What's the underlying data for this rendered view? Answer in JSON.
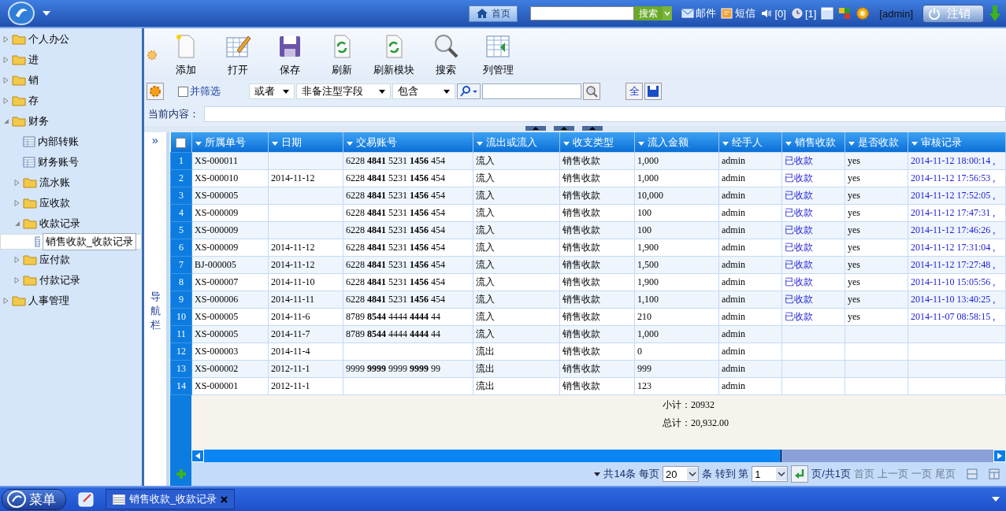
{
  "topbar": {
    "home": "首页",
    "search_button": "搜索",
    "mail": "邮件",
    "sms": "短信",
    "sound_count": "[0]",
    "reminder_count": "[1]",
    "user": "[admin]",
    "logout": "注销"
  },
  "sidebar": {
    "items": [
      {
        "label": "个人办公",
        "kind": "folder",
        "expanded": false,
        "selected": false
      },
      {
        "label": "进",
        "kind": "folder",
        "expanded": false,
        "selected": false
      },
      {
        "label": "销",
        "kind": "folder",
        "expanded": false,
        "selected": false
      },
      {
        "label": "存",
        "kind": "folder",
        "expanded": false,
        "selected": false
      },
      {
        "label": "财务",
        "kind": "folder",
        "expanded": true,
        "selected": false,
        "children": [
          {
            "label": "内部转账",
            "kind": "page",
            "selected": false
          },
          {
            "label": "财务账号",
            "kind": "page",
            "selected": false
          },
          {
            "label": "流水账",
            "kind": "folder",
            "expanded": false,
            "selected": false
          },
          {
            "label": "应收款",
            "kind": "folder",
            "expanded": false,
            "selected": false
          },
          {
            "label": "收款记录",
            "kind": "folder",
            "expanded": true,
            "selected": false,
            "children": [
              {
                "label": "销售收款_收款记录",
                "kind": "page",
                "selected": true
              }
            ]
          },
          {
            "label": "应付款",
            "kind": "folder",
            "expanded": false,
            "selected": false
          },
          {
            "label": "付款记录",
            "kind": "folder",
            "expanded": false,
            "selected": false
          }
        ]
      },
      {
        "label": "人事管理",
        "kind": "folder",
        "expanded": false,
        "selected": false
      }
    ]
  },
  "toolbar": [
    {
      "label": "添加",
      "kind": "add"
    },
    {
      "label": "打开",
      "kind": "open"
    },
    {
      "label": "保存",
      "kind": "save"
    },
    {
      "label": "刷新",
      "kind": "refresh"
    },
    {
      "label": "刷新模块",
      "kind": "refresh"
    },
    {
      "label": "搜索",
      "kind": "search"
    },
    {
      "label": "列管理",
      "kind": "columns"
    }
  ],
  "filter": {
    "combine_label": "并筛选",
    "combine_checked": false,
    "logic": "或者",
    "field": "非备注型字段",
    "operator": "包含",
    "select_all": "全"
  },
  "current_content": {
    "label": "当前内容："
  },
  "nav_strip": {
    "expand": "»",
    "label": "导航栏"
  },
  "table": {
    "header_checked": false,
    "columns": [
      {
        "label": "所属单号",
        "kind": "text"
      },
      {
        "label": "日期",
        "kind": "text"
      },
      {
        "label": "交易账号",
        "kind": "account"
      },
      {
        "label": "流出或流入",
        "kind": "text"
      },
      {
        "label": "收支类型",
        "kind": "text"
      },
      {
        "label": "流入金额",
        "kind": "text"
      },
      {
        "label": "经手人",
        "kind": "text"
      },
      {
        "label": "销售收款",
        "kind": "link"
      },
      {
        "label": "是否收款",
        "kind": "text"
      },
      {
        "label": "审核记录",
        "kind": "link"
      }
    ],
    "rows": [
      {
        "no": "1",
        "cells": [
          "XS-000011",
          "",
          "6228 **4841** 5231 **1456** 454",
          "流入",
          "销售收款",
          "1,000",
          "admin",
          "已收款",
          "yes",
          "2014-11-12 18:00:14 ,"
        ]
      },
      {
        "no": "2",
        "cells": [
          "XS-000010",
          "2014-11-12",
          "6228 **4841** 5231 **1456** 454",
          "流入",
          "销售收款",
          "1,000",
          "admin",
          "已收款",
          "yes",
          "2014-11-12 17:56:53 ,"
        ]
      },
      {
        "no": "3",
        "cells": [
          "XS-000005",
          "",
          "6228 **4841** 5231 **1456** 454",
          "流入",
          "销售收款",
          "10,000",
          "admin",
          "已收款",
          "yes",
          "2014-11-12 17:52:05 ,"
        ]
      },
      {
        "no": "4",
        "cells": [
          "XS-000009",
          "",
          "6228 **4841** 5231 **1456** 454",
          "流入",
          "销售收款",
          "100",
          "admin",
          "已收款",
          "yes",
          "2014-11-12 17:47:31 ,"
        ]
      },
      {
        "no": "5",
        "cells": [
          "XS-000009",
          "",
          "6228 **4841** 5231 **1456** 454",
          "流入",
          "销售收款",
          "100",
          "admin",
          "已收款",
          "yes",
          "2014-11-12 17:46:26 ,"
        ]
      },
      {
        "no": "6",
        "cells": [
          "XS-000009",
          "2014-11-12",
          "6228 **4841** 5231 **1456** 454",
          "流入",
          "销售收款",
          "1,900",
          "admin",
          "已收款",
          "yes",
          "2014-11-12 17:31:04 ,"
        ]
      },
      {
        "no": "7",
        "cells": [
          "BJ-000005",
          "2014-11-12",
          "6228 **4841** 5231 **1456** 454",
          "流入",
          "销售收款",
          "1,500",
          "admin",
          "已收款",
          "yes",
          "2014-11-12 17:27:48 ,"
        ]
      },
      {
        "no": "8",
        "cells": [
          "XS-000007",
          "2014-11-10",
          "6228 **4841** 5231 **1456** 454",
          "流入",
          "销售收款",
          "1,900",
          "admin",
          "已收款",
          "yes",
          "2014-11-10 15:05:56 ,"
        ]
      },
      {
        "no": "9",
        "cells": [
          "XS-000006",
          "2014-11-11",
          "6228 **4841** 5231 **1456** 454",
          "流入",
          "销售收款",
          "1,100",
          "admin",
          "已收款",
          "yes",
          "2014-11-10 13:40:25 ,"
        ]
      },
      {
        "no": "10",
        "cells": [
          "XS-000005",
          "2014-11-6",
          "8789 **8544** 4444 **4444** 44",
          "流入",
          "销售收款",
          "210",
          "admin",
          "已收款",
          "yes",
          "2014-11-07 08:58:15 ,"
        ]
      },
      {
        "no": "11",
        "cells": [
          "XS-000005",
          "2014-11-7",
          "8789 **8544** 4444 **4444** 44",
          "流入",
          "销售收款",
          "1,000",
          "admin",
          "",
          "",
          ""
        ]
      },
      {
        "no": "12",
        "cells": [
          "XS-000003",
          "2014-11-4",
          "",
          "流出",
          "销售收款",
          "0",
          "admin",
          "",
          "",
          ""
        ]
      },
      {
        "no": "13",
        "cells": [
          "XS-000002",
          "2012-11-1",
          "9999 **9999** 9999 **9999** 99",
          "流出",
          "销售收款",
          "999",
          "admin",
          "",
          "",
          ""
        ]
      },
      {
        "no": "14",
        "cells": [
          "XS-000001",
          "2012-11-1",
          "",
          "流出",
          "销售收款",
          "123",
          "admin",
          "",
          "",
          ""
        ]
      }
    ],
    "subtotal": "小计：20932",
    "total": "总计：20,932.00"
  },
  "pager": {
    "count": "共14条",
    "per_page_label": "每页",
    "per_page": "20",
    "goto_label": "条 转到 第",
    "page": "1",
    "pages": "页/共1页",
    "links": [
      {
        "label": "首页",
        "disabled": true
      },
      {
        "label": "上一页",
        "disabled": true
      },
      {
        "label": "一页",
        "disabled": true
      },
      {
        "label": "尾页",
        "disabled": true
      }
    ]
  },
  "taskbar": {
    "menu": "菜单",
    "tabs": [
      {
        "label": "销售收款_收款记录",
        "selected": true
      }
    ]
  }
}
